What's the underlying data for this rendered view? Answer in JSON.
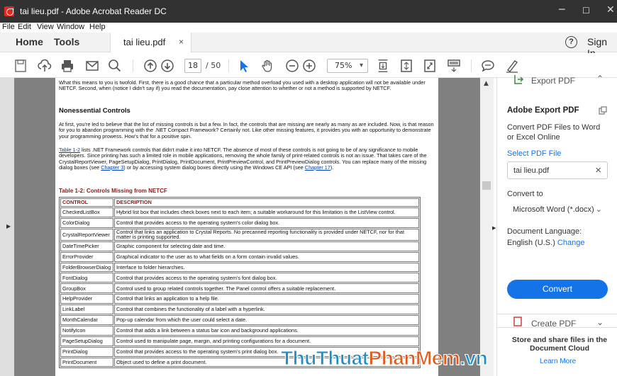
{
  "window": {
    "title": "tai lieu.pdf - Adobe Acrobat Reader DC",
    "minimize": "─",
    "maximize": "☐",
    "close": "✕"
  },
  "menu": [
    "File",
    "Edit",
    "View",
    "Window",
    "Help"
  ],
  "tabs": {
    "home": "Home",
    "tools": "Tools",
    "doc_tab": "tai lieu.pdf",
    "doc_close": "×",
    "help": "?",
    "sign_in": "Sign In"
  },
  "toolbar": {
    "page_current": "18",
    "page_total": "/ 50",
    "zoom": "75%",
    "icons": [
      "save-icon",
      "upload-icon",
      "print-icon",
      "email-icon",
      "search-icon",
      "prev-page-icon",
      "next-page-icon",
      "select-cursor-icon",
      "hand-icon",
      "zoom-out-icon",
      "zoom-in-icon",
      "page-scroll-icon",
      "fit-page-icon",
      "fullscreen-icon",
      "read-mode-icon",
      "comment-icon",
      "sign-icon"
    ]
  },
  "document": {
    "para1": "What this means to you is twofold. First, there is a good chance that a particular method overload you used with a desktop application will not be available under NETCF. Second, when (notice I didn't say if) you read the documentation, pay close attention to whether or not a method is supported by NETCF.",
    "heading": "Nonessential Controls",
    "para2": "At first, you're led to believe that the list of missing controls is but a few. In fact, the controls that are missing are nearly as many as are included. Now, is that reason for you to abandon programming with the .NET Compact Framework? Certainly not. Like other missing features, it provides you with an opportunity to demonstrate your programming prowess. How's that for a positive spin.",
    "para3_link": "Table 1-2",
    "para3_a": " lists .NET Framework controls that didn't make it into NETCF. The absence of most of these controls is not going to be of any significance to mobile developers. Since printing has such a limited role in mobile applications, removing the whole family of print-related controls is not an issue. That takes care of the CrystalReportViewer, PageSetupDialog, PrintDialog, PrintDocument, PrintPreviewControl, and PrintPreviewDialog controls. You can replace many of the missing dialog boxes (see ",
    "para3_link2": "Chapter 3",
    "para3_b": ") or by accessing system dialog boxes directly using the Windows CE API (see ",
    "para3_link3": "Chapter 17",
    "para3_c": ").",
    "table_caption": "Table 1-2: Controls Missing from NETCF",
    "table_headers": [
      "CONTROL",
      "DESCRIPTION"
    ],
    "table_rows": [
      [
        "CheckedListBox",
        "Hybrid list box that includes check boxes next to each item; a suitable workaround for this limitation is the ListView control."
      ],
      [
        "ColorDialog",
        "Control that provides access to the operating system's color dialog box."
      ],
      [
        "CrystalReportViewer",
        "Control that links an application to Crystal Reports. No precanned reporting functionality is provided under NETCF, nor for that matter is printing supported."
      ],
      [
        "DateTimePicker",
        "Graphic component for selecting date and time."
      ],
      [
        "ErrorProvider",
        "Graphical indicator to the user as to what fields on a form contain invalid values."
      ],
      [
        "FolderBrowserDialog",
        "Interface to folder hierarchies."
      ],
      [
        "FontDialog",
        "Control that provides access to the operating system's font dialog box."
      ],
      [
        "GroupBox",
        "Control used to group related controls together. The Panel control offers a suitable replacement."
      ],
      [
        "HelpProvider",
        "Control that links an application to a help file."
      ],
      [
        "LinkLabel",
        "Control that combines the functionality of a label with a hyperlink."
      ],
      [
        "MonthCalendar",
        "Pop-up calendar from which the user could select a date."
      ],
      [
        "NotifyIcon",
        "Control that adds a link between a status bar icon and background applications."
      ],
      [
        "PageSetupDialog",
        "Control used to manipulate page, margin, and printing configurations for a document."
      ],
      [
        "PrintDialog",
        "Control that provides access to the operating system's print dialog box."
      ],
      [
        "PrintDocument",
        "Object used to define a print document."
      ]
    ]
  },
  "panel": {
    "export_top": "Export PDF",
    "title": "Adobe Export PDF",
    "desc": "Convert PDF Files to Word or Excel Online",
    "select_label": "Select PDF File",
    "file_name": "tai lieu.pdf",
    "convert_to_label": "Convert to",
    "convert_to_value": "Microsoft Word (*.docx)",
    "doc_lang_label": "Document Language:",
    "doc_lang_value": "English (U.S.)",
    "change": "Change",
    "convert_button": "Convert",
    "create_pdf": "Create PDF",
    "store_text": "Store and share files in the Document Cloud",
    "learn_more": "Learn More"
  },
  "watermark": {
    "part1": "ThuThuat",
    "part2": "PhanMem",
    "part3": ".vn"
  },
  "colors": {
    "titlebar": "#323232",
    "accent": "#1473e6",
    "doc_bg": "#808080",
    "table_red": "#8b1a1a"
  }
}
